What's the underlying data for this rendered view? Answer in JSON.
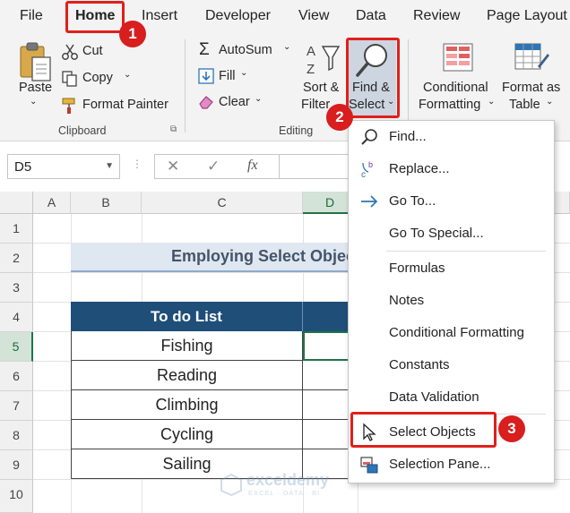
{
  "menubar": {
    "tabs": [
      "File",
      "Home",
      "Insert",
      "Developer",
      "View",
      "Data",
      "Review",
      "Page Layout"
    ]
  },
  "ribbon": {
    "clipboard": {
      "paste": "Paste",
      "cut": "Cut",
      "copy": "Copy",
      "format_painter": "Format Painter",
      "group_label": "Clipboard"
    },
    "editing": {
      "autosum": "AutoSum",
      "fill": "Fill",
      "clear": "Clear",
      "sort_filter_1": "Sort &",
      "sort_filter_2": "Filter",
      "find_select_1": "Find &",
      "find_select_2": "Select",
      "group_label": "Editing"
    },
    "styles": {
      "conditional_1": "Conditional",
      "conditional_2": "Formatting",
      "format_table_1": "Format as",
      "format_table_2": "Table"
    }
  },
  "formula_bar": {
    "name_box": "D5",
    "cancel": "✕",
    "enter": "✓",
    "fx": "fx"
  },
  "grid": {
    "columns": [
      "A",
      "B",
      "C",
      "D"
    ],
    "rows": [
      "1",
      "2",
      "3",
      "4",
      "5",
      "6",
      "7",
      "8",
      "9",
      "10"
    ],
    "title": "Employing Select Objects",
    "table_header": "To do List",
    "items": [
      "Fishing",
      "Reading",
      "Climbing",
      "Cycling",
      "Sailing"
    ]
  },
  "menu": {
    "find": "Find...",
    "replace": "Replace...",
    "goto": "Go To...",
    "goto_special": "Go To Special...",
    "formulas": "Formulas",
    "notes": "Notes",
    "conditional_formatting": "Conditional Formatting",
    "constants": "Constants",
    "data_validation": "Data Validation",
    "select_objects": "Select Objects",
    "selection_pane": "Selection Pane..."
  },
  "callouts": {
    "step1": "1",
    "step2": "2",
    "step3": "3"
  },
  "watermark": {
    "name": "exceldemy",
    "sub": "EXCEL · DATA · BI"
  },
  "colors": {
    "accent_green": "#217346",
    "callout_red": "#d81e1e",
    "table_header_blue": "#1f4e79"
  }
}
